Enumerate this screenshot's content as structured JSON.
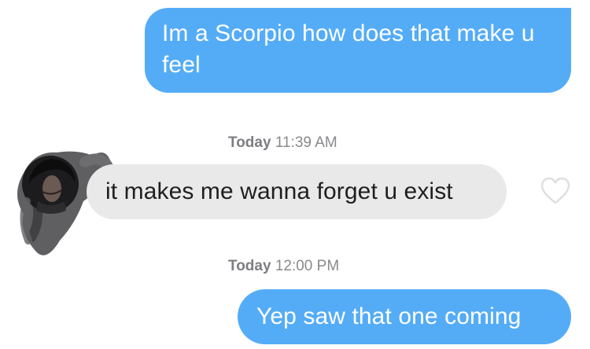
{
  "messages": [
    {
      "direction": "sent",
      "text": "Im a Scorpio how does that make u feel"
    },
    {
      "direction": "received",
      "text": "it makes me wanna forget u exist"
    },
    {
      "direction": "sent",
      "text": "Yep saw that one coming"
    }
  ],
  "timestamps": [
    {
      "day": "Today",
      "time": "11:39 AM"
    },
    {
      "day": "Today",
      "time": "12:00 PM"
    }
  ],
  "icons": {
    "like": "heart-outline-icon",
    "avatar": "contact-avatar-scribbled"
  },
  "colors": {
    "sent_bubble": "#54acf7",
    "received_bubble": "#e9e9ea",
    "timestamp": "#8a8a8e",
    "heart_outline": "#dedee0"
  }
}
